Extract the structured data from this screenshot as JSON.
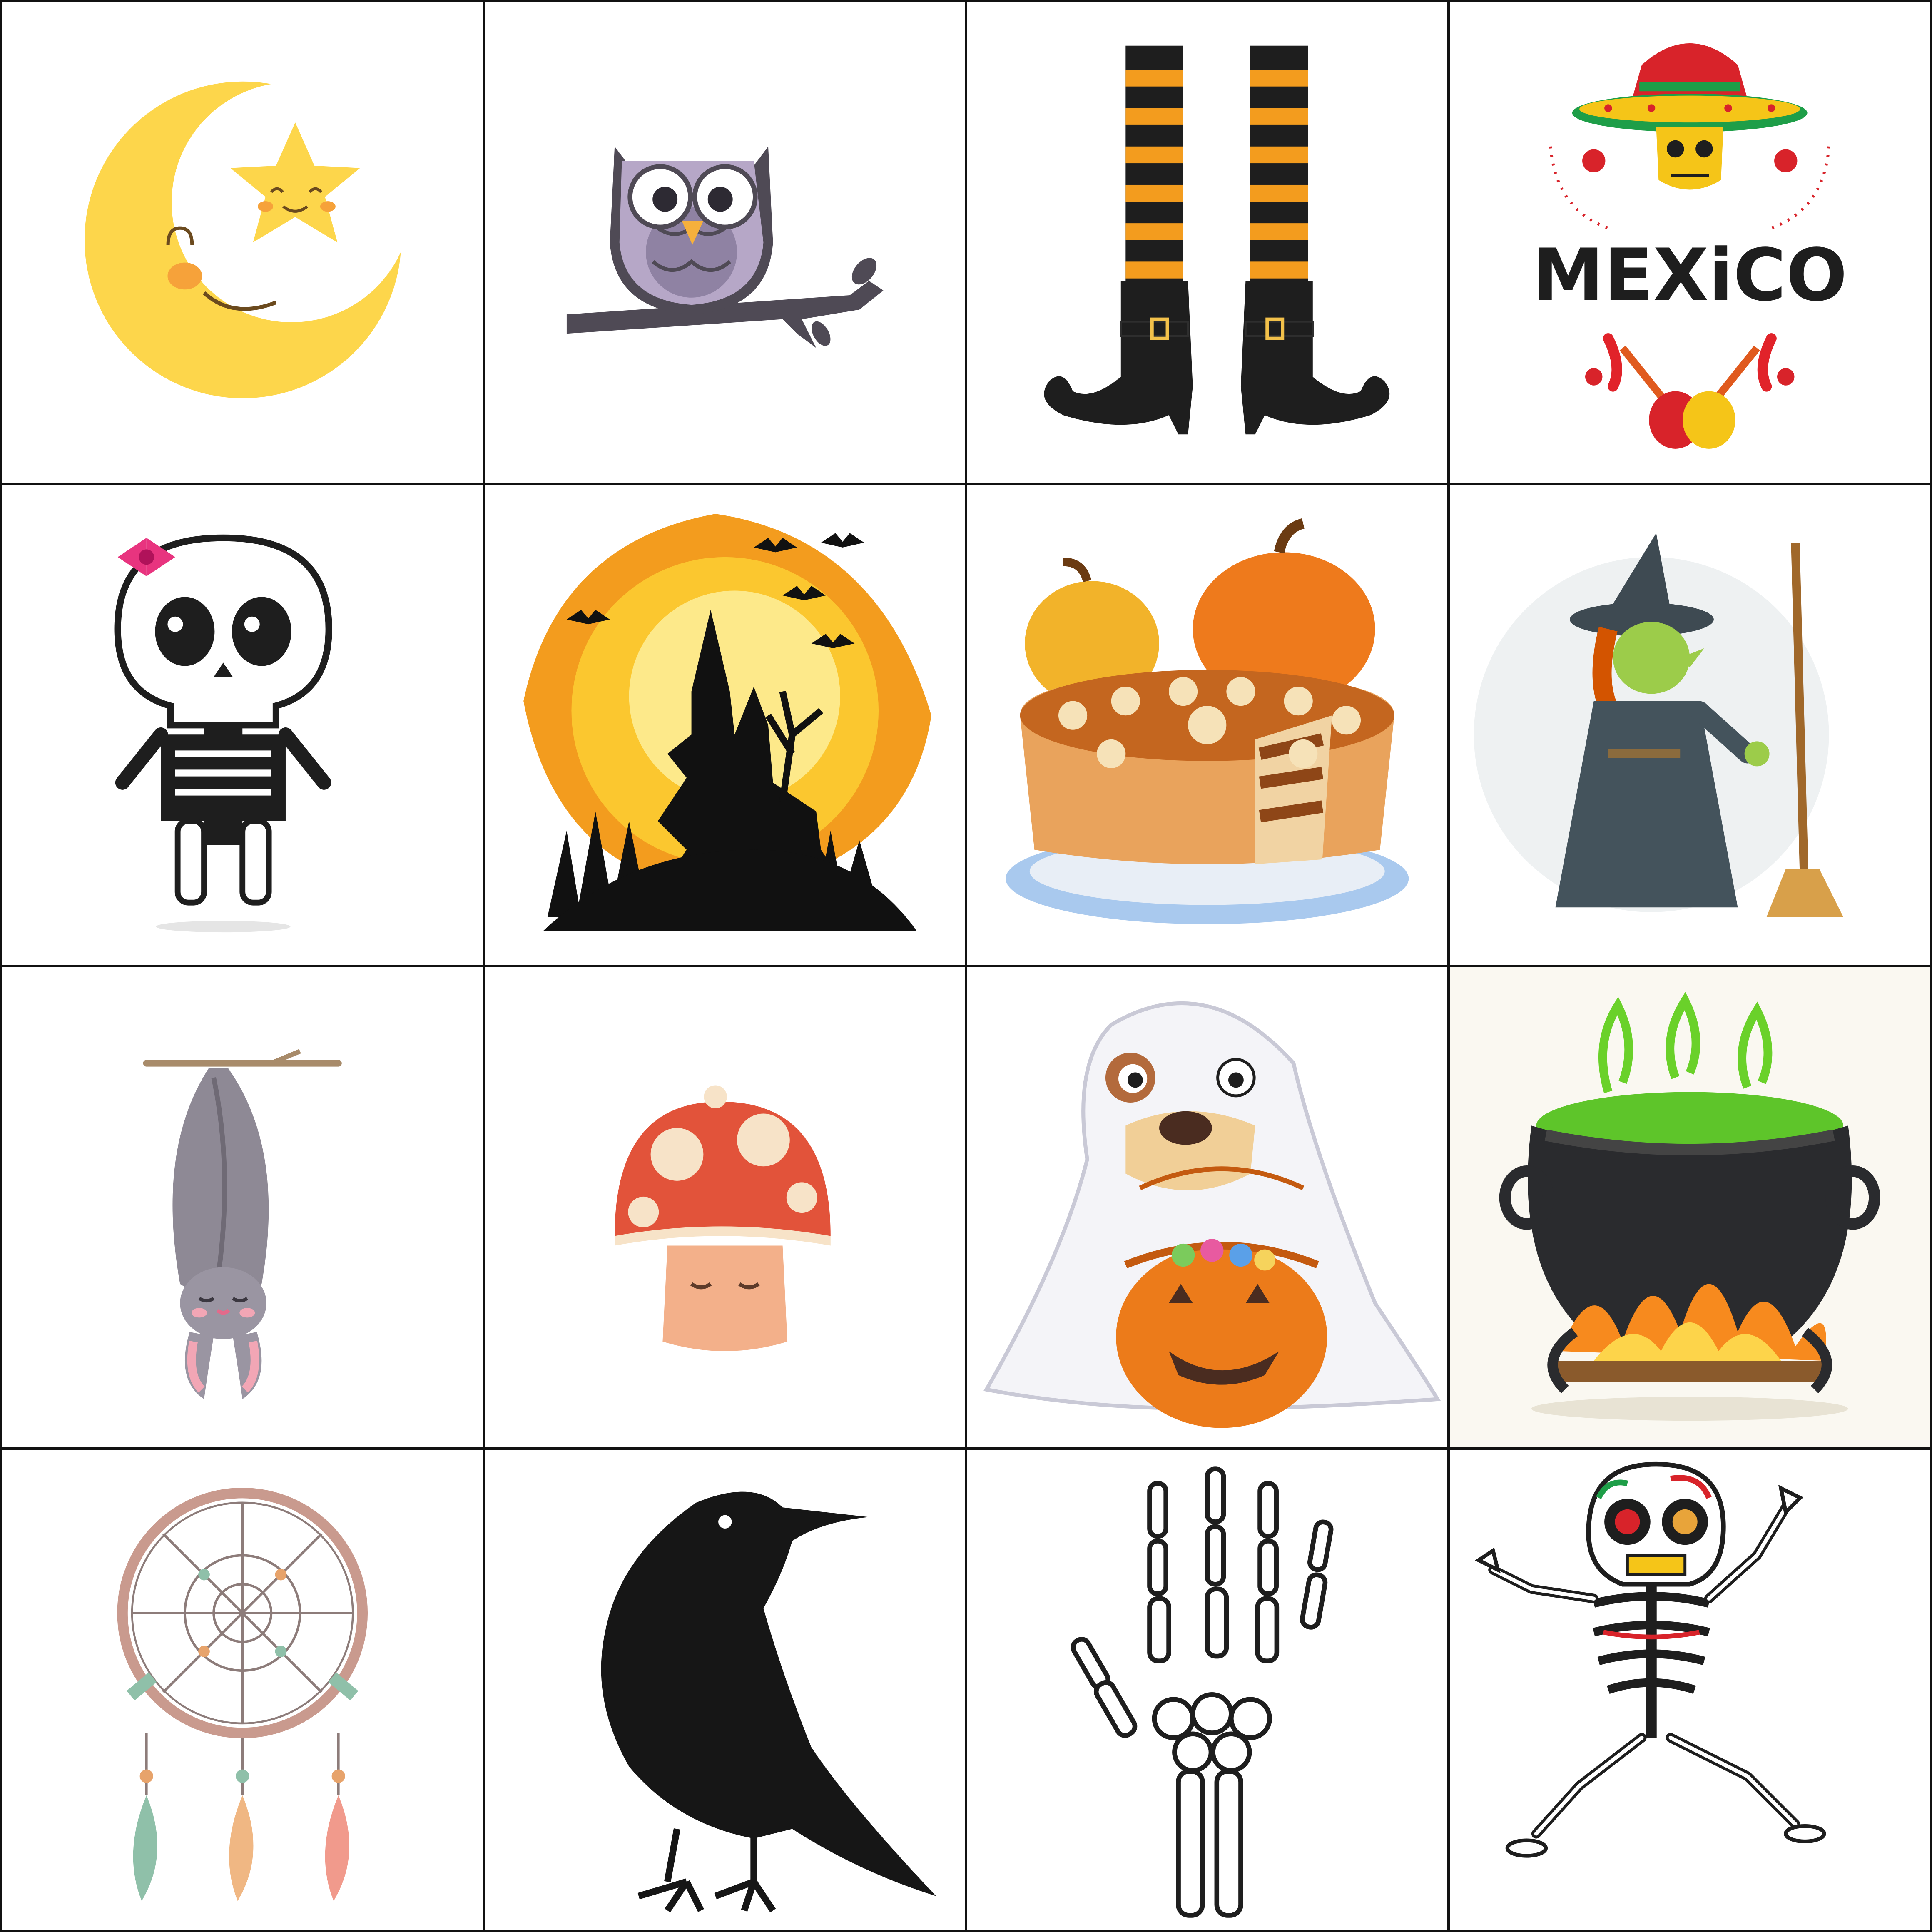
{
  "board": {
    "rows": 4,
    "columns": 4,
    "tiles": [
      {
        "icon": "moon-star-icon"
      },
      {
        "icon": "owl-icon"
      },
      {
        "icon": "witch-boots-icon"
      },
      {
        "icon": "mexico-sombrero-icon",
        "text": "MEXiCO"
      },
      {
        "icon": "cute-skeleton-icon"
      },
      {
        "icon": "haunted-castle-icon"
      },
      {
        "icon": "pumpkin-pie-icon"
      },
      {
        "icon": "witch-broom-icon"
      },
      {
        "icon": "hanging-bat-icon"
      },
      {
        "icon": "mushroom-icon"
      },
      {
        "icon": "ghost-dog-icon"
      },
      {
        "icon": "cauldron-icon"
      },
      {
        "icon": "dreamcatcher-icon"
      },
      {
        "icon": "crow-icon"
      },
      {
        "icon": "skeleton-hand-icon"
      },
      {
        "icon": "dancing-skeleton-icon"
      }
    ]
  },
  "colors": {
    "grid_line": "#111111",
    "moon_yellow": "#fdd64b",
    "orange": "#f39c1e",
    "black": "#1b1b1b",
    "mexico_red": "#d8232a",
    "mexico_green": "#1e9e48"
  }
}
